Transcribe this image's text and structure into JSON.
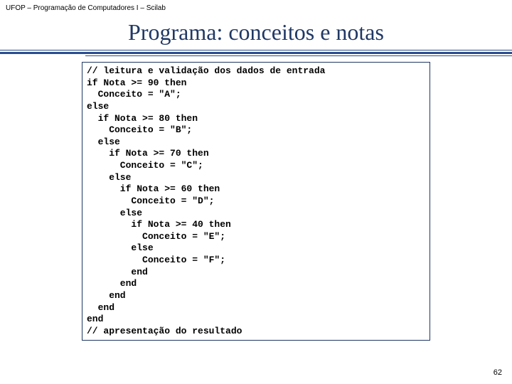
{
  "header": "UFOP – Programação de Computadores I – Scilab",
  "title": "Programa: conceitos e notas",
  "code": "// leitura e validação dos dados de entrada\nif Nota >= 90 then\n  Conceito = \"A\";\nelse\n  if Nota >= 80 then\n    Conceito = \"B\";\n  else\n    if Nota >= 70 then\n      Conceito = \"C\";\n    else\n      if Nota >= 60 then\n        Conceito = \"D\";\n      else\n        if Nota >= 40 then\n          Conceito = \"E\";\n        else\n          Conceito = \"F\";\n        end\n      end\n    end\n  end\nend\n// apresentação do resultado",
  "page_number": "62"
}
